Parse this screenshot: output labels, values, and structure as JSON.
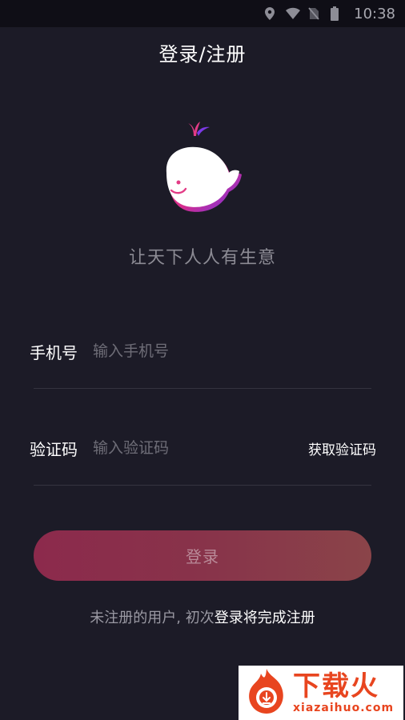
{
  "status_bar": {
    "time": "10:38",
    "icons": [
      "location-icon",
      "wifi-icon",
      "no-sim-icon",
      "battery-icon"
    ]
  },
  "header": {
    "title": "登录/注册"
  },
  "brand": {
    "logo_icon": "whale-logo-icon",
    "slogan": "让天下人人有生意"
  },
  "form": {
    "phone": {
      "label": "手机号",
      "placeholder": "输入手机号",
      "value": ""
    },
    "code": {
      "label": "验证码",
      "placeholder": "输入验证码",
      "value": "",
      "get_code_label": "获取验证码"
    },
    "login_label": "登录"
  },
  "notice": {
    "prefix": "未注册的用户, 初次",
    "emphasis": "登录将完成注册"
  },
  "watermark": {
    "title": "下载火",
    "domain": "xiazaihuo.com"
  },
  "colors": {
    "background": "#1c1b27",
    "button_gradient_start": "#8c2a4c",
    "button_gradient_end": "#8a4449",
    "watermark_accent": "#e8451f"
  }
}
